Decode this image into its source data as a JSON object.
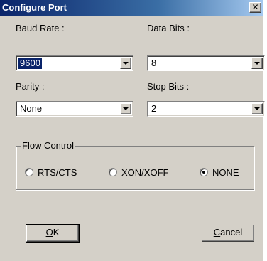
{
  "window": {
    "title": "Configure Port",
    "close_glyph": "✕"
  },
  "fields": {
    "baud_rate": {
      "label": "Baud Rate :",
      "value": "9600"
    },
    "data_bits": {
      "label": "Data Bits :",
      "value": "8"
    },
    "parity": {
      "label": "Parity :",
      "value": "None"
    },
    "stop_bits": {
      "label": "Stop Bits :",
      "value": "2"
    }
  },
  "flow_control": {
    "title": "Flow Control",
    "options": [
      {
        "label": "RTS/CTS",
        "checked": false
      },
      {
        "label": "XON/XOFF",
        "checked": false
      },
      {
        "label": "NONE",
        "checked": true
      }
    ]
  },
  "buttons": {
    "ok": {
      "mnemonic": "O",
      "rest": "K"
    },
    "cancel": {
      "mnemonic": "C",
      "rest": "ancel"
    }
  },
  "icons": {
    "close": "close-icon",
    "dropdown": "chevron-down-icon"
  },
  "colors": {
    "title_bar": "#0a246a",
    "dialog_bg": "#d4d0c8",
    "selection": "#0a246a"
  }
}
